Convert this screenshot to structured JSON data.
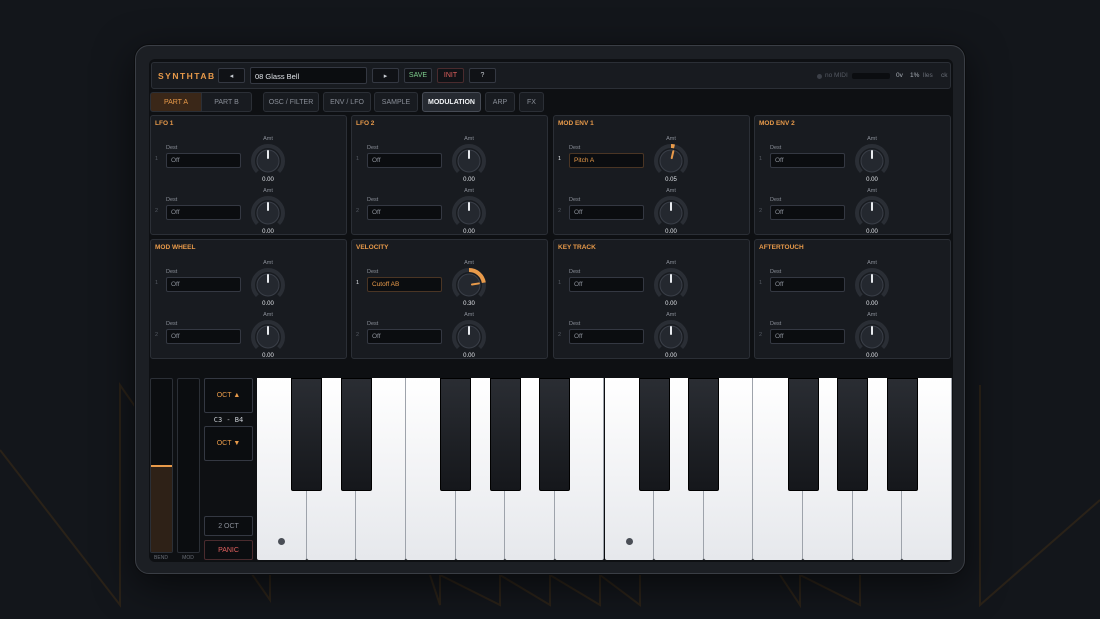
{
  "app": {
    "logo": "SYNTHTAB"
  },
  "topbar": {
    "prev_label": "◂",
    "patch_name": "08 Glass Bell",
    "next_label": "▸",
    "save_label": "SAVE",
    "init_label": "INIT",
    "help_label": "?",
    "midi_status": "no MIDI",
    "voices": "0v",
    "cpu": "1%",
    "latency": "lles",
    "clock": "ck"
  },
  "parts": {
    "a": "PART A",
    "b": "PART B",
    "active": "PART A"
  },
  "tabs": [
    {
      "label": "OSC / FILTER",
      "active": false
    },
    {
      "label": "ENV / LFO",
      "active": false
    },
    {
      "label": "SAMPLE",
      "active": false
    },
    {
      "label": "MODULATION",
      "active": true
    },
    {
      "label": "ARP",
      "active": false
    },
    {
      "label": "FX",
      "active": false
    }
  ],
  "panels": [
    {
      "title": "LFO 1",
      "slots": [
        {
          "num": "1",
          "dest": "Off",
          "amt": 0,
          "amt_text": "0.00"
        },
        {
          "num": "2",
          "dest": "Off",
          "amt": 0,
          "amt_text": "0.00"
        }
      ]
    },
    {
      "title": "LFO 2",
      "slots": [
        {
          "num": "1",
          "dest": "Off",
          "amt": 0,
          "amt_text": "0.00"
        },
        {
          "num": "2",
          "dest": "Off",
          "amt": 0,
          "amt_text": "0.00"
        }
      ]
    },
    {
      "title": "MOD ENV 1",
      "slots": [
        {
          "num": "1",
          "dest": "Pitch A",
          "amt": 0.05,
          "amt_text": "0.05"
        },
        {
          "num": "2",
          "dest": "Off",
          "amt": 0,
          "amt_text": "0.00"
        }
      ]
    },
    {
      "title": "MOD ENV 2",
      "slots": [
        {
          "num": "1",
          "dest": "Off",
          "amt": 0,
          "amt_text": "0.00"
        },
        {
          "num": "2",
          "dest": "Off",
          "amt": 0,
          "amt_text": "0.00"
        }
      ]
    },
    {
      "title": "MOD WHEEL",
      "slots": [
        {
          "num": "1",
          "dest": "Off",
          "amt": 0,
          "amt_text": "0.00"
        },
        {
          "num": "2",
          "dest": "Off",
          "amt": 0,
          "amt_text": "0.00"
        }
      ]
    },
    {
      "title": "VELOCITY",
      "slots": [
        {
          "num": "1",
          "dest": "Cutoff AB",
          "amt": 0.3,
          "amt_text": "0.30"
        },
        {
          "num": "2",
          "dest": "Off",
          "amt": 0,
          "amt_text": "0.00"
        }
      ]
    },
    {
      "title": "KEY TRACK",
      "slots": [
        {
          "num": "1",
          "dest": "Off",
          "amt": 0,
          "amt_text": "0.00"
        },
        {
          "num": "2",
          "dest": "Off",
          "amt": 0,
          "amt_text": "0.00"
        }
      ]
    },
    {
      "title": "AFTERTOUCH",
      "slots": [
        {
          "num": "1",
          "dest": "Off",
          "amt": 0,
          "amt_text": "0.00"
        },
        {
          "num": "2",
          "dest": "Off",
          "amt": 0,
          "amt_text": "0.00"
        }
      ]
    }
  ],
  "labels": {
    "dest": "Dest",
    "amt": "Amt"
  },
  "wheels": {
    "bend_label": "BEND",
    "mod_label": "MOD",
    "bend_value": 0.5,
    "mod_value": 0
  },
  "octave": {
    "up_label": "OCT ▲",
    "down_label": "OCT ▼",
    "range": "C3 - B4",
    "span_label": "2 OCT",
    "panic_label": "PANIC"
  },
  "keyboard": {
    "white_keys": 14,
    "marked_keys": [
      "C3",
      "C4"
    ]
  },
  "colors": {
    "accent": "#e89a4a",
    "danger": "#e0605e",
    "ok": "#7fcf8e",
    "bg": "#13161b"
  }
}
